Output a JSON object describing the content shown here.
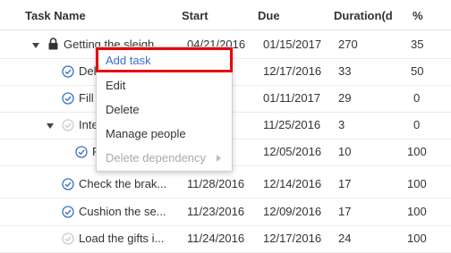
{
  "columns": {
    "task_name": "Task Name",
    "start": "Start",
    "due": "Due",
    "duration": "Duration(d",
    "percent": "%"
  },
  "rows": [
    {
      "name": "Getting the sleigh",
      "start": "04/21/2016",
      "due": "01/15/2017",
      "duration": "270",
      "percent": "35"
    },
    {
      "name": "Deliver list",
      "start": "",
      "due": "12/17/2016",
      "duration": "33",
      "percent": "50"
    },
    {
      "name": "Fill",
      "start": "",
      "due": "01/11/2017",
      "duration": "29",
      "percent": "0"
    },
    {
      "name": "Inter",
      "start": "",
      "due": "11/25/2016",
      "duration": "3",
      "percent": "0"
    },
    {
      "name": "F",
      "start": "",
      "due": "12/05/2016",
      "duration": "10",
      "percent": "100"
    },
    {
      "name": "Check the brak...",
      "start": "11/28/2016",
      "due": "12/14/2016",
      "duration": "17",
      "percent": "100"
    },
    {
      "name": "Cushion the se...",
      "start": "11/23/2016",
      "due": "12/09/2016",
      "duration": "17",
      "percent": "100"
    },
    {
      "name": "Load the gifts i...",
      "start": "11/24/2016",
      "due": "12/17/2016",
      "duration": "24",
      "percent": "100"
    }
  ],
  "context_menu": {
    "add_task": "Add task",
    "edit": "Edit",
    "delete": "Delete",
    "manage_people": "Manage people",
    "delete_dependency": "Delete dependency"
  },
  "colors": {
    "accent": "#3b6fc9",
    "highlight": "#e8000b"
  }
}
